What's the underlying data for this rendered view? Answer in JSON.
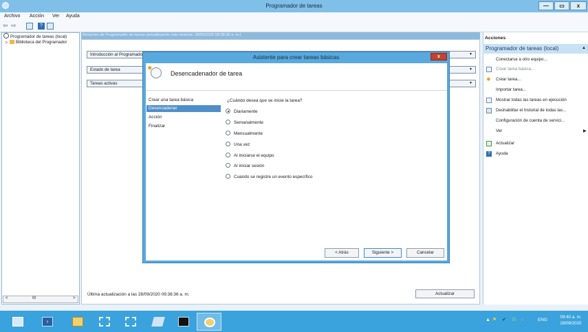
{
  "window": {
    "title": "Programador de tareas",
    "controls": {
      "minimize": "—",
      "maximize": "▭",
      "close": "x"
    }
  },
  "menu": [
    "Archivo",
    "Acción",
    "Ver",
    "Ayuda"
  ],
  "tree": {
    "root": "Programador de tareas (local)",
    "child": "Biblioteca del Programador"
  },
  "center": {
    "header": "Resumen de Programador de tareas (actualización más reciente: 28/09/2020 09:38:36 a. m.)",
    "sections": [
      "Introducción al Programador",
      "Estado de tarea",
      "Tareas activas"
    ],
    "status": "Última actualización a las 28/09/2020 09:38:36 a. m.",
    "refresh": "Actualizar"
  },
  "actions": {
    "title": "Acciones",
    "subheader": "Programador de tareas (local)",
    "items": [
      {
        "label": "Conectarse a otro equipo...",
        "icon": "none"
      },
      {
        "label": "Crear tarea básica...",
        "icon": "wizard-icon",
        "dim": true
      },
      {
        "label": "Crear tarea...",
        "icon": "new-task-icon"
      },
      {
        "label": "Importar tarea...",
        "icon": "none"
      },
      {
        "label": "Mostrar todas las tareas en ejecución",
        "icon": "list-icon"
      },
      {
        "label": "Deshabilitar el historial de todas las...",
        "icon": "history-icon"
      },
      {
        "label": "Configuración de cuenta de servici...",
        "icon": "none"
      },
      {
        "label": "Ver",
        "icon": "none",
        "submenu": "▶"
      },
      {
        "label": "Actualizar",
        "icon": "refresh-icon"
      },
      {
        "label": "Ayuda",
        "icon": "help-icon"
      }
    ]
  },
  "dialog": {
    "title": "Asistente para crear tareas básicas",
    "close": "x",
    "heading": "Desencadenador de tarea",
    "steps": [
      "Crear una tarea básica",
      "Desencadenar",
      "Acción",
      "Finalizar"
    ],
    "question": "¿Cuándo desea que se inicie la tarea?",
    "options": [
      {
        "label": "Diariamente",
        "selected": true
      },
      {
        "label": "Semanalmente",
        "selected": false
      },
      {
        "label": "Mensualmente",
        "selected": false
      },
      {
        "label": "Una vez",
        "selected": false
      },
      {
        "label": "Al iniciarse el equipo",
        "selected": false
      },
      {
        "label": "Al iniciar sesión",
        "selected": false
      },
      {
        "label": "Cuando se registre un evento específico",
        "selected": false
      }
    ],
    "buttons": {
      "back": "< Atrás",
      "next": "Siguiente >",
      "cancel": "Cancelar"
    }
  },
  "scrollbar": {
    "left": "<",
    "thumb": "III",
    "right": ">"
  },
  "taskbar": {
    "apps": [
      "server-manager-icon",
      "powershell-icon",
      "file-explorer-icon",
      "network-icon",
      "network-alt-icon",
      "tools-icon",
      "command-prompt-icon",
      "task-scheduler-icon"
    ],
    "lang": "ENG",
    "time": "09:40 a. m.",
    "date": "28/09/2020"
  },
  "colors": {
    "accent": "#3aa2dd",
    "title": "#7fbfe8",
    "selection": "#4f8fc9",
    "dialog_frame": "#58a9de"
  }
}
